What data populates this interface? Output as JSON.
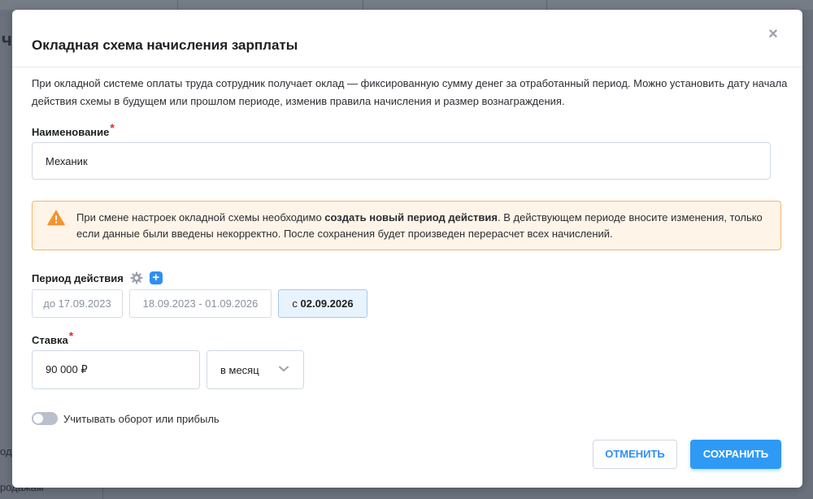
{
  "background": {
    "glyph": "ч",
    "text_1": "ода",
    "text_2": "родажам"
  },
  "modal": {
    "title": "Окладная схема начисления зарплаты",
    "close_symbol": "×",
    "description": "При окладной системе оплаты труда сотрудник получает оклад — фиксированную сумму денег за отработанный период. Можно установить дату начала действия схемы в будущем или прошлом периоде, изменив правила начисления и размер вознаграждения."
  },
  "name_field": {
    "label": "Наименование",
    "required_mark": "*",
    "value": "Механик"
  },
  "warning": {
    "icon": "warning-triangle-icon",
    "text_before": "При смене настроек окладной схемы необходимо ",
    "text_bold": "создать новый период действия",
    "text_after": ". В действующем периоде вносите изменения, только если данные были введены некорректно. После сохранения будет произведен перерасчет всех начислений."
  },
  "period": {
    "label": "Период действия",
    "tabs": [
      {
        "label": "до 17.09.2023"
      },
      {
        "label": "18.09.2023 - 01.09.2026"
      },
      {
        "prefix": "с ",
        "date": "02.09.2026"
      }
    ]
  },
  "rate": {
    "label": "Ставка",
    "required_mark": "*",
    "value": "90 000 ₽",
    "unit": "в месяц"
  },
  "toggle": {
    "label": "Учитывать оборот или прибыль",
    "on": false
  },
  "buttons": {
    "cancel": "ОТМЕНИТЬ",
    "save": "СОХРАНИТЬ"
  },
  "colors": {
    "accent": "#2f9af5",
    "warning_bg": "#fff4e8",
    "warning_border": "#f5b56b",
    "warning_icon": "#f5932e",
    "required": "#e02b2b"
  }
}
